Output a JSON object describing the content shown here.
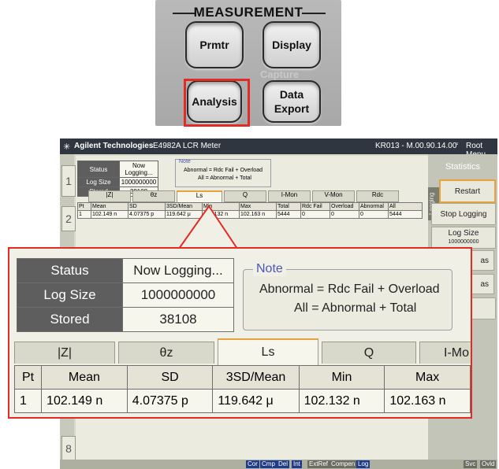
{
  "panel": {
    "title": "MEASUREMENT",
    "buttons": {
      "prmtr": "Prmtr",
      "display": "Display",
      "analysis": "Analysis",
      "data_export": "Data Export"
    },
    "capture_label": "Capture"
  },
  "screen": {
    "titlebar": {
      "brand": "Agilent Technologies",
      "model": "E4982A LCR Meter",
      "status": "KR013 - M.00.90.14.00",
      "menu": "Root Menu"
    },
    "tab_numbers": [
      "1",
      "2",
      "8"
    ],
    "status": {
      "status_label": "Status",
      "status_value": "Now Logging...",
      "logsize_label": "Log Size",
      "logsize_value": "1000000000",
      "stored_label": "Stored",
      "stored_value": "38108"
    },
    "note": {
      "title": "Note",
      "line1": "Abnormal = Rdc Fail + Overload",
      "line2": "All = Abnormal + Total"
    },
    "tabs": [
      "|Z|",
      "θz",
      "Ls",
      "Q",
      "I-Mon",
      "V-Mon",
      "Rdc"
    ],
    "columns": [
      "Pt",
      "Mean",
      "SD",
      "3SD/Mean",
      "Min",
      "Max",
      "Total",
      "Rdc Fail",
      "Overload",
      "Abnormal",
      "All"
    ],
    "row": [
      "1",
      "102.149 n",
      "4.07375 p",
      "119.642 μ",
      "102.132 n",
      "102.163 n",
      "5444",
      "0",
      "0",
      "0",
      "5444"
    ],
    "sidebar": {
      "title": "Statistics",
      "restart": "Restart",
      "stop_logging": "Stop Logging",
      "log_size": "Log Size",
      "log_size_value": "1000000000",
      "vertical": "Logging",
      "partial1": "as",
      "partial2": "as"
    },
    "statusbar": [
      "Cor",
      "Cmp",
      "Del",
      "Int",
      "ExtRef",
      "Compen",
      "Log",
      "Svc",
      "Ovld"
    ]
  },
  "zoom": {
    "status_label": "Status",
    "status_value": "Now Logging...",
    "logsize_label": "Log Size",
    "logsize_value": "1000000000",
    "stored_label": "Stored",
    "stored_value": "38108",
    "note_title": "Note",
    "note_line1": "Abnormal = Rdc Fail + Overload",
    "note_line2": "All = Abnormal + Total",
    "tabs": [
      "|Z|",
      "θz",
      "Ls",
      "Q",
      "I-Mo"
    ],
    "columns": [
      "Pt",
      "Mean",
      "SD",
      "3SD/Mean",
      "Min",
      "Max"
    ],
    "row": [
      "1",
      "102.149 n",
      "4.07375 p",
      "119.642 μ",
      "102.132 n",
      "102.163 n"
    ]
  }
}
